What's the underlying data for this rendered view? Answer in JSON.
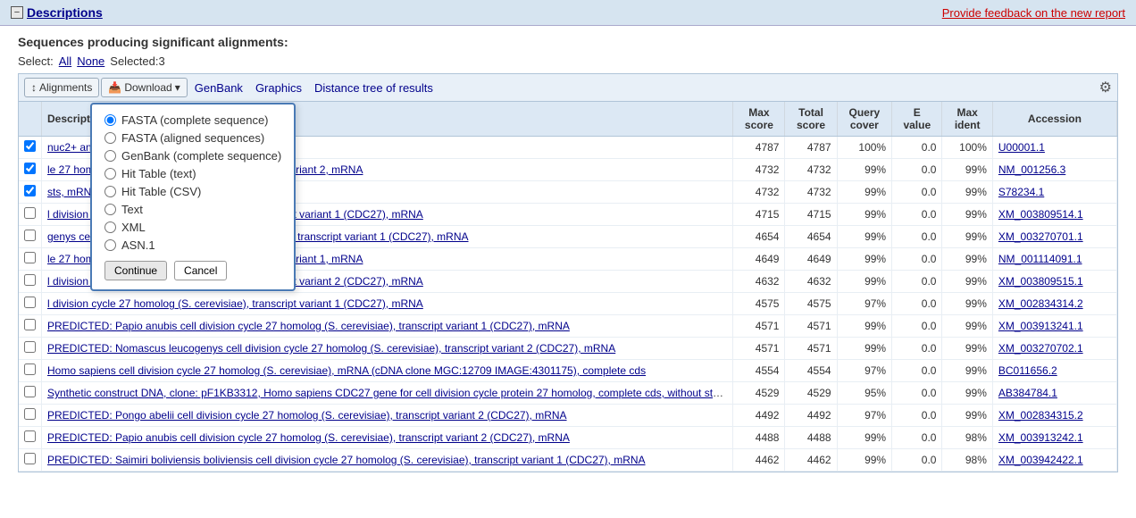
{
  "topbar": {
    "minus_label": "−",
    "descriptions_label": "Descriptions",
    "feedback_label": "Provide feedback on the new report"
  },
  "sequences_section": {
    "header": "Sequences producing significant alignments:",
    "select_label": "Select:",
    "select_all": "All",
    "select_none": "None",
    "selected_count": "Selected:3"
  },
  "toolbar": {
    "alignments_label": "Alignments",
    "download_label": "Download",
    "genbank_label": "GenBank",
    "graphics_label": "Graphics",
    "distance_tree_label": "Distance tree of results",
    "gear_symbol": "⚙"
  },
  "download_dropdown": {
    "options": [
      {
        "id": "fasta_complete",
        "label": "FASTA (complete sequence)",
        "checked": true
      },
      {
        "id": "fasta_aligned",
        "label": "FASTA (aligned sequences)",
        "checked": false
      },
      {
        "id": "genbank_complete",
        "label": "GenBank (complete sequence)",
        "checked": false
      },
      {
        "id": "hit_table_text",
        "label": "Hit Table (text)",
        "checked": false
      },
      {
        "id": "hit_table_csv",
        "label": "Hit Table (CSV)",
        "checked": false
      },
      {
        "id": "text",
        "label": "Text",
        "checked": false
      },
      {
        "id": "xml",
        "label": "XML",
        "checked": false
      },
      {
        "id": "asn1",
        "label": "ASN.1",
        "checked": false
      }
    ],
    "continue_label": "Continue",
    "cancel_label": "Cancel"
  },
  "table": {
    "columns": [
      "",
      "Description",
      "Max score",
      "Total score",
      "Query cover",
      "E value",
      "Max ident",
      "Accession"
    ],
    "rows": [
      {
        "desc": "nuc2+ and A. nidulans bimA",
        "max_score": "4787",
        "total_score": "4787",
        "query_cover": "100%",
        "e_value": "0.0",
        "max_ident": "100%",
        "accession": "U00001.1",
        "checked": true
      },
      {
        "desc": "le 27 homolog (S. cerevisiae) (CDC27), transcript variant 2, mRNA",
        "max_score": "4732",
        "total_score": "4732",
        "query_cover": "99%",
        "e_value": "0.0",
        "max_ident": "99%",
        "accession": "NM_001256.3",
        "checked": true
      },
      {
        "desc": "sts, mRNA, 3320 nt]",
        "max_score": "4732",
        "total_score": "4732",
        "query_cover": "99%",
        "e_value": "0.0",
        "max_ident": "99%",
        "accession": "S78234.1",
        "checked": true
      },
      {
        "desc": "l division cycle 27 homolog (S. cerevisiae), transcript variant 1 (CDC27), mRNA",
        "max_score": "4715",
        "total_score": "4715",
        "query_cover": "99%",
        "e_value": "0.0",
        "max_ident": "99%",
        "accession": "XM_003809514.1",
        "checked": false
      },
      {
        "desc": "genys cell division cycle 27 homolog (S. cerevisiae), transcript variant 1 (CDC27), mRNA",
        "max_score": "4654",
        "total_score": "4654",
        "query_cover": "99%",
        "e_value": "0.0",
        "max_ident": "99%",
        "accession": "XM_003270701.1",
        "checked": false
      },
      {
        "desc": "le 27 homolog (S. cerevisiae) (CDC27), transcript variant 1, mRNA",
        "max_score": "4649",
        "total_score": "4649",
        "query_cover": "99%",
        "e_value": "0.0",
        "max_ident": "99%",
        "accession": "NM_001114091.1",
        "checked": false
      },
      {
        "desc": "l division cycle 27 homolog (S. cerevisiae), transcript variant 2 (CDC27), mRNA",
        "max_score": "4632",
        "total_score": "4632",
        "query_cover": "99%",
        "e_value": "0.0",
        "max_ident": "99%",
        "accession": "XM_003809515.1",
        "checked": false
      },
      {
        "desc": "l division cycle 27 homolog (S. cerevisiae), transcript variant 1 (CDC27), mRNA",
        "max_score": "4575",
        "total_score": "4575",
        "query_cover": "97%",
        "e_value": "0.0",
        "max_ident": "99%",
        "accession": "XM_002834314.2",
        "checked": false
      },
      {
        "desc": "PREDICTED: Papio anubis cell division cycle 27 homolog (S. cerevisiae), transcript variant 1 (CDC27), mRNA",
        "max_score": "4571",
        "total_score": "4571",
        "query_cover": "99%",
        "e_value": "0.0",
        "max_ident": "99%",
        "accession": "XM_003913241.1",
        "checked": false
      },
      {
        "desc": "PREDICTED: Nomascus leucogenys cell division cycle 27 homolog (S. cerevisiae), transcript variant 2 (CDC27), mRNA",
        "max_score": "4571",
        "total_score": "4571",
        "query_cover": "99%",
        "e_value": "0.0",
        "max_ident": "99%",
        "accession": "XM_003270702.1",
        "checked": false
      },
      {
        "desc": "Homo sapiens cell division cycle 27 homolog (S. cerevisiae), mRNA (cDNA clone MGC:12709 IMAGE:4301175), complete cds",
        "max_score": "4554",
        "total_score": "4554",
        "query_cover": "97%",
        "e_value": "0.0",
        "max_ident": "99%",
        "accession": "BC011656.2",
        "checked": false
      },
      {
        "desc": "Synthetic construct DNA, clone: pF1KB3312, Homo sapiens CDC27 gene for cell division cycle protein 27 homolog, complete cds, without stop c",
        "max_score": "4529",
        "total_score": "4529",
        "query_cover": "95%",
        "e_value": "0.0",
        "max_ident": "99%",
        "accession": "AB384784.1",
        "checked": false
      },
      {
        "desc": "PREDICTED: Pongo abelii cell division cycle 27 homolog (S. cerevisiae), transcript variant 2 (CDC27), mRNA",
        "max_score": "4492",
        "total_score": "4492",
        "query_cover": "97%",
        "e_value": "0.0",
        "max_ident": "99%",
        "accession": "XM_002834315.2",
        "checked": false
      },
      {
        "desc": "PREDICTED: Papio anubis cell division cycle 27 homolog (S. cerevisiae), transcript variant 2 (CDC27), mRNA",
        "max_score": "4488",
        "total_score": "4488",
        "query_cover": "99%",
        "e_value": "0.0",
        "max_ident": "98%",
        "accession": "XM_003913242.1",
        "checked": false
      },
      {
        "desc": "PREDICTED: Saimiri boliviensis boliviensis cell division cycle 27 homolog (S. cerevisiae), transcript variant 1 (CDC27), mRNA",
        "max_score": "4462",
        "total_score": "4462",
        "query_cover": "99%",
        "e_value": "0.0",
        "max_ident": "98%",
        "accession": "XM_003942422.1",
        "checked": false
      }
    ]
  }
}
